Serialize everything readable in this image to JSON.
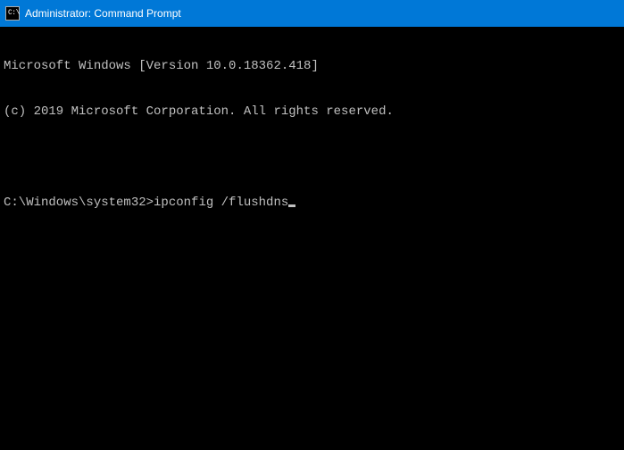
{
  "titlebar": {
    "icon_label": "C:\\",
    "title": "Administrator: Command Prompt"
  },
  "console": {
    "line1": "Microsoft Windows [Version 10.0.18362.418]",
    "line2": "(c) 2019 Microsoft Corporation. All rights reserved.",
    "prompt": "C:\\Windows\\system32>",
    "command": "ipconfig /flushdns"
  }
}
